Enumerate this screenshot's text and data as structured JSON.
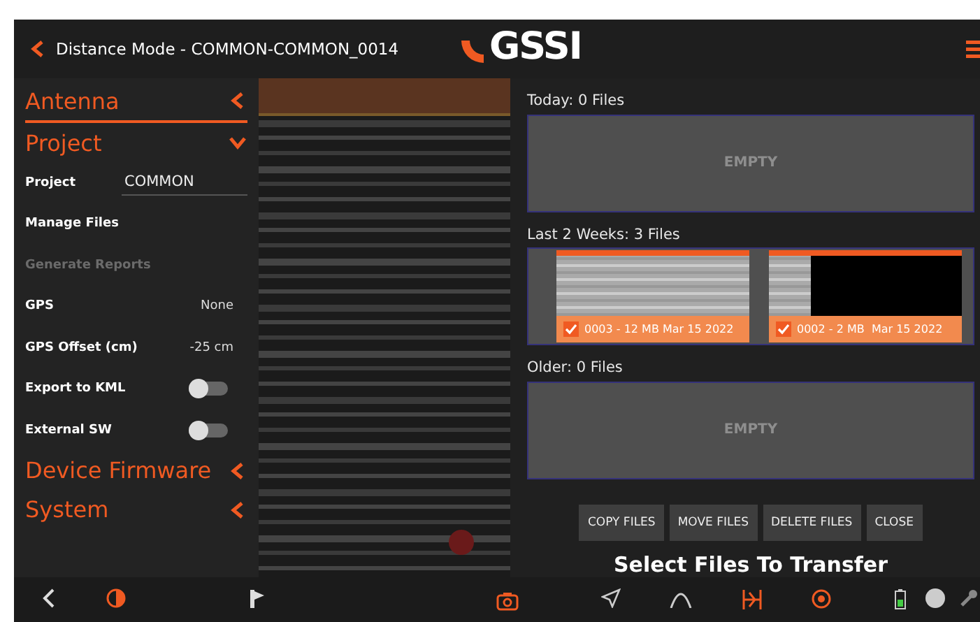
{
  "header": {
    "title": "Distance Mode - COMMON-COMMON_0014",
    "logo": "GSSI"
  },
  "sidebar": {
    "sections": [
      {
        "label": "Antenna",
        "expanded": false
      },
      {
        "label": "Project",
        "expanded": true,
        "items": [
          {
            "kind": "field",
            "label": "Project",
            "value": "COMMON"
          },
          {
            "kind": "link",
            "label": "Manage Files",
            "disabled": false
          },
          {
            "kind": "link",
            "label": "Generate Reports",
            "disabled": true
          },
          {
            "kind": "value",
            "label": "GPS",
            "value": "None"
          },
          {
            "kind": "value",
            "label": "GPS Offset (cm)",
            "value": "-25 cm"
          },
          {
            "kind": "toggle",
            "label": "Export to KML",
            "on": false
          },
          {
            "kind": "toggle",
            "label": "External SW",
            "on": false
          }
        ]
      },
      {
        "label": "Device Firmware",
        "expanded": false
      },
      {
        "label": "System",
        "expanded": false
      }
    ]
  },
  "file_panel": {
    "groups": [
      {
        "label": "Today: 0 Files",
        "empty_text": "EMPTY"
      },
      {
        "label": "Last 2 Weeks: 3 Files",
        "files": [
          {
            "label": "0003 - 12 MB Mar 15 2022",
            "checked": true,
            "kind": "full"
          },
          {
            "label": "0002 - 2 MB  Mar 15 2022",
            "checked": true,
            "kind": "short"
          }
        ]
      },
      {
        "label": "Older: 0 Files",
        "empty_text": "EMPTY"
      }
    ],
    "buttons": [
      "COPY FILES",
      "MOVE FILES",
      "DELETE FILES",
      "CLOSE"
    ],
    "message": "Select Files To Transfer"
  }
}
